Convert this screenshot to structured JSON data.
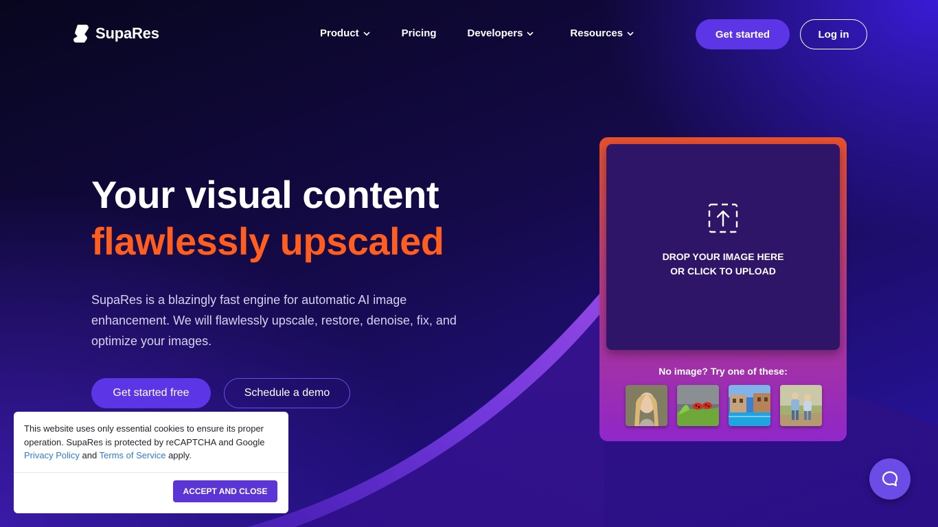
{
  "brand": {
    "name": "SupaRes"
  },
  "nav": {
    "items": [
      {
        "label": "Product",
        "has_dropdown": true
      },
      {
        "label": "Pricing",
        "has_dropdown": false
      },
      {
        "label": "Developers",
        "has_dropdown": true
      },
      {
        "label": "Resources",
        "has_dropdown": true
      }
    ],
    "get_started": "Get started",
    "login": "Log in"
  },
  "hero": {
    "title_line1": "Your visual content",
    "title_line2": "flawlessly upscaled",
    "description": "SupaRes is a blazingly fast engine for automatic AI image enhancement. We will flawlessly upscale, restore, denoise, fix, and optimize your images.",
    "cta_primary": "Get started free",
    "cta_secondary": "Schedule a demo"
  },
  "upload": {
    "drop_line1": "DROP YOUR IMAGE HERE",
    "drop_line2": "OR CLICK TO UPLOAD",
    "try_label": "No image? Try one of these:",
    "samples": [
      "portrait-sample",
      "ladybugs-sample",
      "pool-sample",
      "kids-sample"
    ]
  },
  "cookie": {
    "text_before": "This website uses only essential cookies to ensure its proper operation. SupaRes is protected by reCAPTCHA and Google",
    "privacy_link": "Privacy Policy",
    "and": "and",
    "terms_link": "Terms of Service",
    "text_after": "apply.",
    "accept": "ACCEPT AND CLOSE"
  },
  "colors": {
    "accent": "#5b35e6",
    "highlight": "#ff5e1f",
    "link": "#2d7bd6"
  },
  "icons": {
    "chat": "chat-bubble-icon",
    "upload": "upload-icon",
    "dropdown": "chevron-down-icon"
  }
}
